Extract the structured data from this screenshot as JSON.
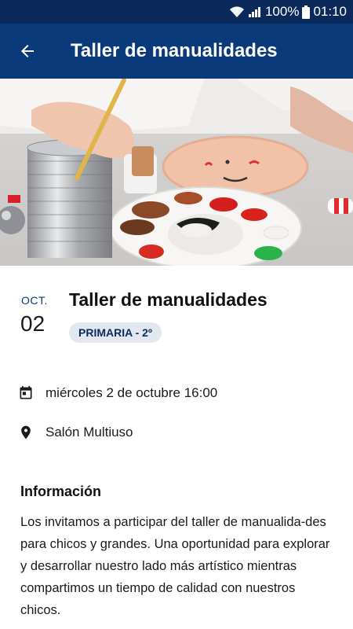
{
  "status_bar": {
    "battery": "100%",
    "time": "01:10"
  },
  "app_bar": {
    "title": "Taller de manualidades",
    "back_icon": "arrow-back-icon"
  },
  "hero": {
    "image": "craft-painting-photo"
  },
  "event": {
    "month": "OCT.",
    "day": "02",
    "title": "Taller de manualidades",
    "badge": "PRIMARIA - 2º"
  },
  "details": {
    "datetime": "miércoles 2 de octubre 16:00",
    "location": "Salón Multiuso"
  },
  "info": {
    "heading": "Información",
    "body": "Los invitamos a participar del taller de manualida-des para chicos y grandes. Una oportunidad para explorar y desarrollar nuestro lado más artístico mientras compartimos un tiempo de calidad con nuestros chicos."
  },
  "colors": {
    "status_bar": "#0b2a5b",
    "app_bar": "#0b3a7a",
    "badge_bg": "#e3e8f0",
    "accent": "#0b3a7a"
  }
}
